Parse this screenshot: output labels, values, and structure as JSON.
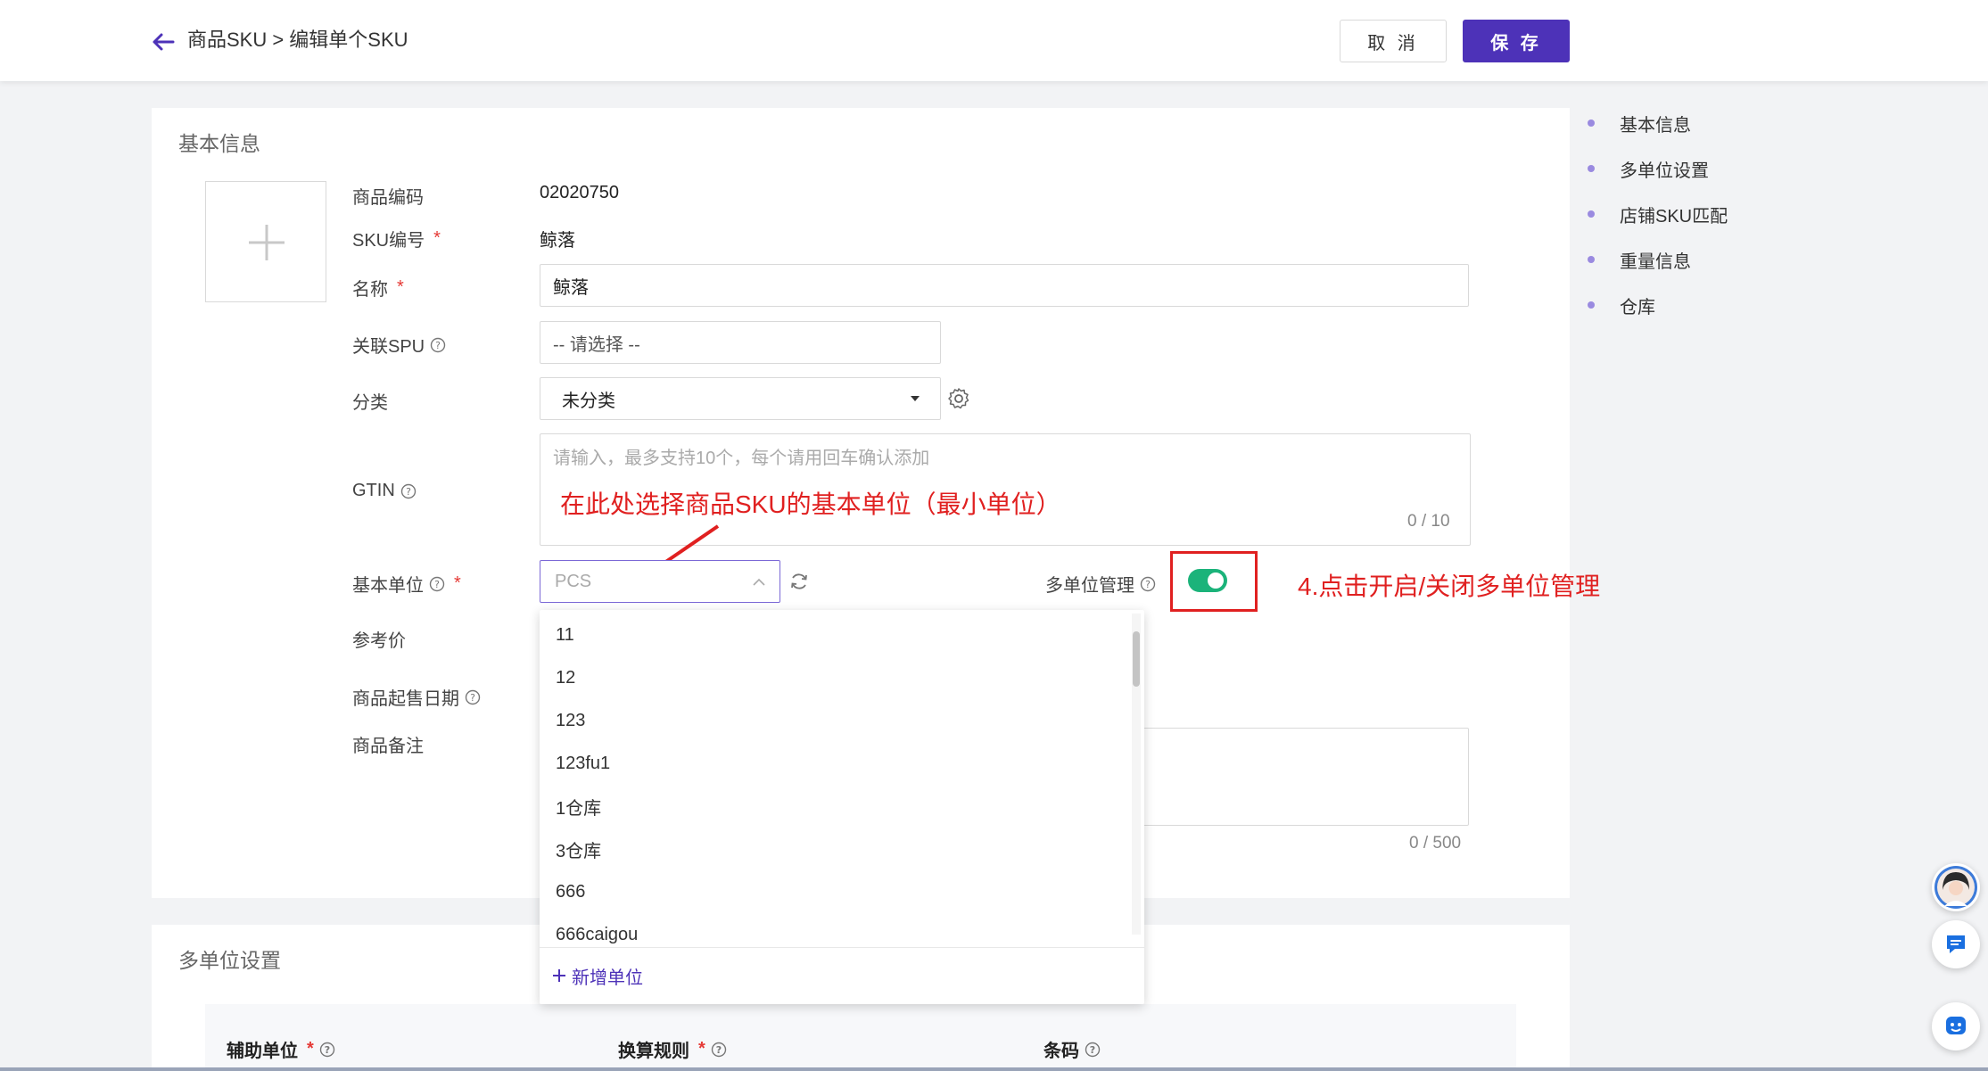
{
  "header": {
    "breadcrumb": "商品SKU > 编辑单个SKU",
    "cancel_label": "取 消",
    "save_label": "保 存"
  },
  "basic_info": {
    "title": "基本信息",
    "fields": {
      "product_code": {
        "label": "商品编码",
        "value": "02020750"
      },
      "sku_code": {
        "label": "SKU编号",
        "required": "*",
        "value": "鲸落"
      },
      "name": {
        "label": "名称",
        "required": "*",
        "value": "鲸落"
      },
      "spu": {
        "label": "关联SPU",
        "placeholder": "-- 请选择 --"
      },
      "category": {
        "label": "分类",
        "value": "未分类"
      },
      "gtin": {
        "label": "GTIN",
        "placeholder": "请输入，最多支持10个，每个请用回车确认添加",
        "counter": "0 / 10"
      },
      "base_unit": {
        "label": "基本单位",
        "required": "*",
        "placeholder": "PCS"
      },
      "multi_unit": {
        "label": "多单位管理"
      },
      "ref_price": {
        "label": "参考价"
      },
      "sale_date": {
        "label": "商品起售日期"
      },
      "remark": {
        "label": "商品备注",
        "counter": "0 / 500"
      }
    },
    "annotation_base_unit": "在此处选择商品SKU的基本单位（最小单位）",
    "annotation_toggle": "4.点击开启/关闭多单位管理"
  },
  "unit_dropdown": {
    "options": [
      "11",
      "12",
      "123",
      "123fu1",
      "1仓库",
      "3仓库",
      "666",
      "666caigou"
    ],
    "add_label": "新增单位"
  },
  "multi_unit_section": {
    "title": "多单位设置",
    "columns": [
      {
        "label": "辅助单位",
        "required": "*"
      },
      {
        "label": "换算规则",
        "required": "*"
      },
      {
        "label": "条码",
        "required": ""
      }
    ]
  },
  "side_nav": {
    "items": [
      "基本信息",
      "多单位设置",
      "店铺SKU匹配",
      "重量信息",
      "仓库"
    ]
  },
  "colors": {
    "primary": "#4d32b8",
    "toggle_on": "#1bb37a",
    "annotation": "#e02020"
  }
}
